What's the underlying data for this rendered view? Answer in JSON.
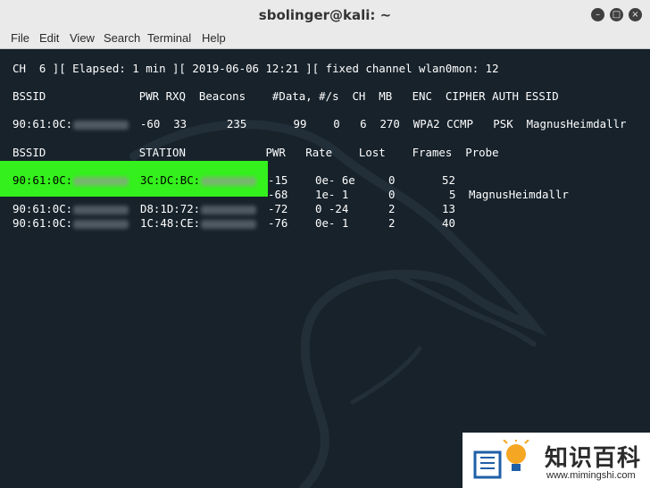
{
  "window": {
    "title": "sbolinger@kali: ~",
    "controls": {
      "minimize": "minimize-icon",
      "maximize": "maximize-icon",
      "close": "close-icon"
    }
  },
  "menu": [
    "File",
    "Edit",
    "View",
    "Search",
    "Terminal",
    "Help"
  ],
  "terminal": {
    "status_line": "CH  6 ][ Elapsed: 1 min ][ 2019-06-06 12:21 ][ fixed channel wlan0mon: 12",
    "ap_header": "BSSID              PWR RXQ  Beacons    #Data, #/s  CH  MB   ENC  CIPHER AUTH ESSID",
    "ap_row": {
      "bssid": "90:61:0C:",
      "rest": "  -60  33      235       99    0   6  270  WPA2 CCMP   PSK  MagnusHeimdallr"
    },
    "station_header": "BSSID              STATION            PWR   Rate    Lost    Frames  Probe",
    "stations": [
      {
        "bssid": "90:61:0C:",
        "station": "3C:DC:BC:",
        "pwr": "-15",
        "rate": "0e- 6e",
        "lost": "0",
        "frames": "52",
        "probe": ""
      },
      {
        "bssid": "",
        "station": "",
        "pwr": "-68",
        "rate": "1e- 1",
        "lost": "0",
        "frames": "5",
        "probe": "MagnusHeimdallr"
      },
      {
        "bssid": "90:61:0C:",
        "station": "D8:1D:72:",
        "pwr": "-72",
        "rate": "0 -24",
        "lost": "2",
        "frames": "13",
        "probe": ""
      },
      {
        "bssid": "90:61:0C:",
        "station": "1C:48:CE:",
        "pwr": "-76",
        "rate": "0e- 1",
        "lost": "2",
        "frames": "40",
        "probe": ""
      }
    ]
  },
  "watermark": {
    "brand": "知识百科",
    "url": "www.mimingshi.com"
  },
  "colors": {
    "terminal_bg": "#17222b",
    "highlight": "#34f01c",
    "titlebar": "#eaeaea"
  }
}
